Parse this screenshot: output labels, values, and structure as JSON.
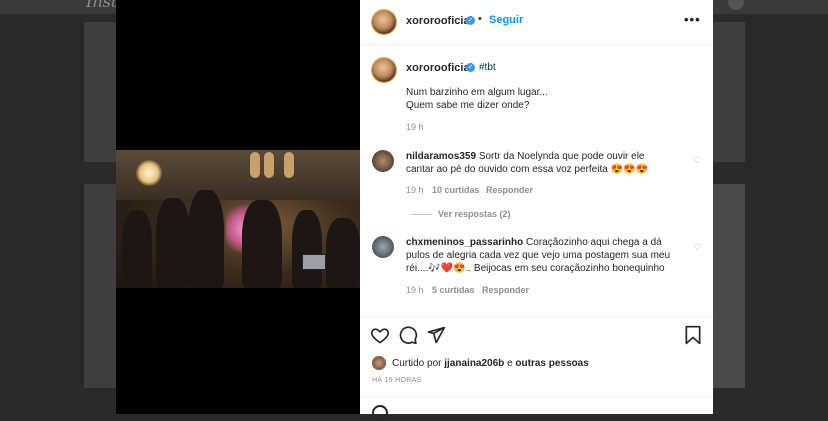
{
  "background": {
    "logo": "Instagram"
  },
  "post": {
    "header": {
      "username": "xororooficial",
      "separator": "•",
      "follow_label": "Seguir",
      "more_icon": "•••"
    },
    "caption": {
      "username": "xororooficial",
      "hashtag": "#tbt",
      "line1": "Num barzinho em algum lugar...",
      "line2": "Quem sabe me dizer onde?",
      "time": "19 h"
    },
    "comments": [
      {
        "username": "nildaramos359",
        "text1": "Sortr da Noelynda que pode ouvir ele",
        "text2": "cantar ao pé do ouvido com essa voz perfeita 😍😍😍",
        "time": "19 h",
        "likes": "10 curtidas",
        "reply": "Responder",
        "view_replies": "Ver respostas (2)"
      },
      {
        "username": "chxmeninos_passarinho",
        "text1": "Coraçãozinho aqui chega a dá",
        "text2": "pulos de alegria cada vez que vejo uma postagem sua meu",
        "text3": "réi....🎶❤️😍.. Beijocas em seu coraçãozinho bonequinho",
        "time": "19 h",
        "likes": "5 curtidas",
        "reply": "Responder"
      }
    ],
    "liked_by": {
      "prefix": "Curtido por",
      "user": "jjanaina206b",
      "conj": "e",
      "others": "outras pessoas"
    },
    "timestamp": "HÁ 19 HORAS",
    "icons": {
      "like": "heart-icon",
      "comment": "comment-icon",
      "share": "share-icon",
      "save": "bookmark-icon"
    }
  },
  "colors": {
    "accent": "#0095f6",
    "verified": "#3897f0",
    "text": "#262626",
    "muted": "#8e8e8e"
  }
}
